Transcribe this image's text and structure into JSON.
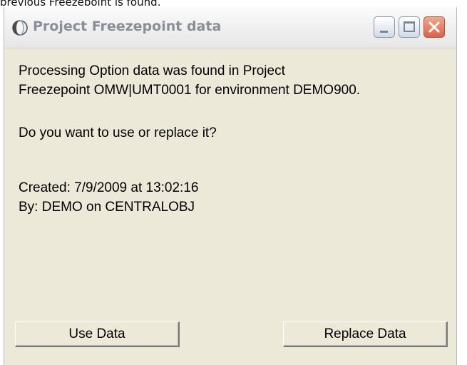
{
  "caption": "previous Freezepoint is found.",
  "window": {
    "title": "Project Freezepoint data"
  },
  "message": {
    "line1": "Processing Option data was found in Project",
    "line2": "Freezepoint OMW|UMT0001 for environment DEMO900.",
    "question": "Do you want to use or replace it?",
    "created": "Created: 7/9/2009 at 13:02:16",
    "by": "By: DEMO on CENTRALOBJ"
  },
  "buttons": {
    "use": "Use Data",
    "replace": "Replace Data"
  }
}
